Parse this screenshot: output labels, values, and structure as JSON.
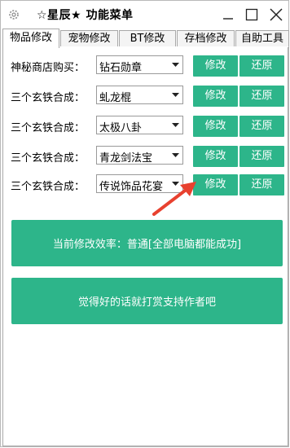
{
  "window": {
    "title": "☆星辰★ 功能菜单"
  },
  "tabs": [
    {
      "label": "物品修改",
      "active": true
    },
    {
      "label": "宠物修改",
      "active": false
    },
    {
      "label": "BT修改",
      "active": false
    },
    {
      "label": "存档修改",
      "active": false
    },
    {
      "label": "自助工具",
      "active": false
    }
  ],
  "rows": [
    {
      "label": "神秘商店购买：",
      "value": "钻石勋章",
      "edit": "修改",
      "restore": "还原"
    },
    {
      "label": "三个玄铁合成：",
      "value": "虬龙棍",
      "edit": "修改",
      "restore": "还原"
    },
    {
      "label": "三个玄铁合成：",
      "value": "太极八卦",
      "edit": "修改",
      "restore": "还原"
    },
    {
      "label": "三个玄铁合成：",
      "value": "青龙剑法宝",
      "edit": "修改",
      "restore": "还原"
    },
    {
      "label": "三个玄铁合成：",
      "value": "传说饰品花宴",
      "edit": "修改",
      "restore": "还原"
    }
  ],
  "status_button": "当前修改效率：普通[全部电脑都能成功]",
  "support_button": "觉得好的话就打赏支持作者吧",
  "colors": {
    "accent": "#2db58a",
    "annotation_arrow": "#e8412f"
  }
}
